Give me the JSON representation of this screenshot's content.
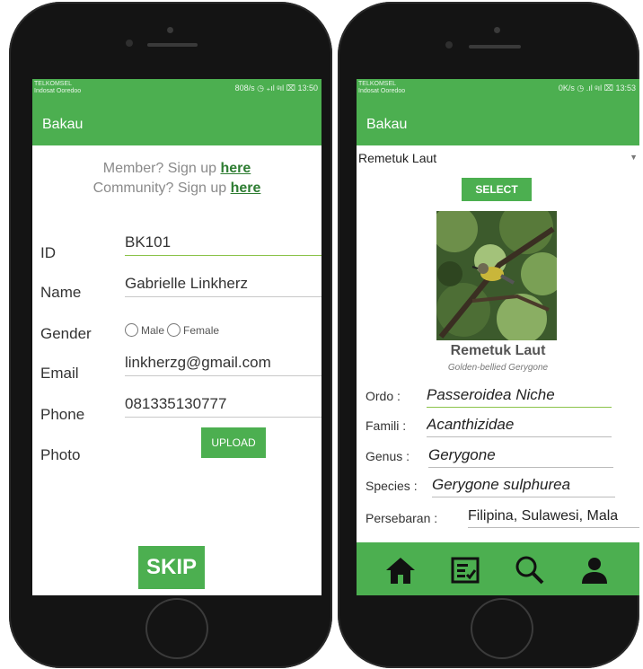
{
  "left_phone": {
    "status": {
      "carrier_line1": "TELKOMSEL",
      "carrier_line2": "Indosat Ooredoo",
      "right": "808/s ◷ ₊ıl ᵍıl ⌧ 13:50"
    },
    "toolbar_title": "Bakau",
    "signup": {
      "member_text": "Member? Sign up ",
      "member_link": "here",
      "community_text": "Community? Sign up ",
      "community_link": "here"
    },
    "form": {
      "id_label": "ID",
      "id_value": "BK101",
      "name_label": "Name",
      "name_value": "Gabrielle Linkherz",
      "gender_label": "Gender",
      "gender_male": "Male",
      "gender_female": "Female",
      "email_label": "Email",
      "email_value": "linkherzg@gmail.com",
      "phone_label": "Phone",
      "phone_value": "081335130777",
      "photo_label": "Photo",
      "upload_label": "UPLOAD"
    },
    "skip_label": "SKIP"
  },
  "right_phone": {
    "status": {
      "carrier_line1": "TELKOMSEL",
      "carrier_line2": "Indosat Ooredoo",
      "right": "0K/s ◷ .ıl ᵍıl ⌧ 13:53"
    },
    "toolbar_title": "Bakau",
    "dropdown_value": "Remetuk Laut",
    "select_label": "SELECT",
    "bird_name": "Remetuk Laut",
    "bird_scientific": "Golden-bellied Gerygone",
    "details": {
      "ordo_label": "Ordo :",
      "ordo_value": "Passeroidea Niche",
      "famili_label": "Famili :",
      "famili_value": "Acanthizidae",
      "genus_label": "Genus :",
      "genus_value": "Gerygone",
      "species_label": "Species :",
      "species_value": "Gerygone sulphurea",
      "persebaran_label": "Persebaran :",
      "persebaran_value": "Filipina, Sulawesi, Mala"
    },
    "nav": [
      "home-icon",
      "list-icon",
      "search-icon",
      "person-icon"
    ]
  },
  "colors": {
    "primary": "#4caf50",
    "phone_body": "#141414",
    "link": "#2e7d32"
  }
}
